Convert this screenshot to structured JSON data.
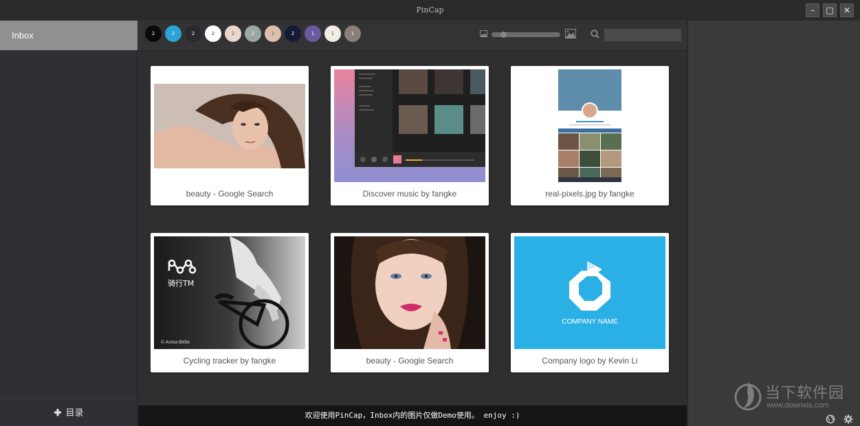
{
  "window": {
    "title": "PinCap",
    "minimize_label": "–",
    "maximize_label": "□",
    "close_label": "✕"
  },
  "sidebar": {
    "inbox_label": "Inbox",
    "catalog_plus": "✚",
    "catalog_label": "目录"
  },
  "toolbar": {
    "color_swatches": [
      {
        "color": "#0a0a0a",
        "count": "2",
        "text_color": "#ffffff"
      },
      {
        "color": "#2ba3d6",
        "count": "2",
        "text_color": "#ffffff"
      },
      {
        "color": "#2a2a2e",
        "count": "2",
        "text_color": "#ffffff"
      },
      {
        "color": "#ffffff",
        "count": "2",
        "text_color": "#333333"
      },
      {
        "color": "#e9d7cc",
        "count": "2",
        "text_color": "#555555"
      },
      {
        "color": "#9aa7a3",
        "count": "2",
        "text_color": "#ffffff"
      },
      {
        "color": "#dcbfae",
        "count": "1",
        "text_color": "#555555"
      },
      {
        "color": "#151a36",
        "count": "2",
        "text_color": "#ffffff"
      },
      {
        "color": "#6a5aa0",
        "count": "1",
        "text_color": "#ffffff"
      },
      {
        "color": "#f2ece6",
        "count": "1",
        "text_color": "#555555"
      },
      {
        "color": "#8a7f79",
        "count": "1",
        "text_color": "#ffffff"
      }
    ],
    "search_placeholder": "",
    "zoom_level": 0.14
  },
  "cards": [
    {
      "caption": "beauty - Google Search",
      "thumb": "portrait-woman-shoulder"
    },
    {
      "caption": "Discover music by fangke",
      "thumb": "music-app-ui"
    },
    {
      "caption": "real-pixels.jpg by fangke",
      "thumb": "mobile-profile-ui"
    },
    {
      "caption": "Cycling tracker by fangke",
      "thumb": "cycling-bw-photo",
      "logo_text": "骑行TM",
      "credit": "© Anisa Bella"
    },
    {
      "caption": "beauty - Google Search",
      "thumb": "portrait-woman-face"
    },
    {
      "caption": "Company logo by Kevin Li",
      "thumb": "company-logo",
      "logo_text": "COMPANY NAME"
    }
  ],
  "status": {
    "message": "欢迎使用PinCap，Inbox内的图片仅做Demo使用。 enjoy :)"
  },
  "watermark": {
    "name": "当下软件园",
    "url": "www.downxia.com"
  },
  "colors": {
    "accent_blue": "#2bb0e6",
    "sidebar_active": "#8f9092"
  }
}
